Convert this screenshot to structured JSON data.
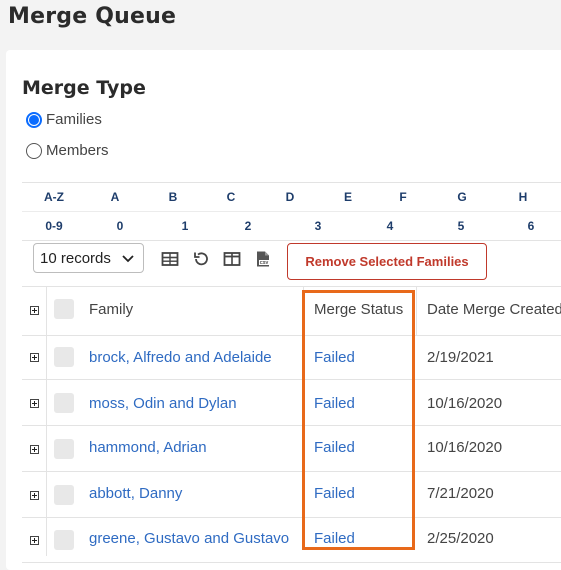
{
  "page": {
    "title": "Merge Queue"
  },
  "merge_type": {
    "title": "Merge Type",
    "options": [
      {
        "label": "Families",
        "checked": true
      },
      {
        "label": "Members",
        "checked": false
      }
    ]
  },
  "alpha_filter": {
    "row1": [
      "A-Z",
      "A",
      "B",
      "C",
      "D",
      "E",
      "F",
      "G",
      "H"
    ],
    "row2": [
      "0-9",
      "0",
      "1",
      "2",
      "3",
      "4",
      "5",
      "6"
    ]
  },
  "toolbar": {
    "records_select": "10 records",
    "icons": [
      "table-icon",
      "refresh-icon",
      "columns-icon",
      "csv-export-icon"
    ],
    "remove_button": "Remove Selected Families"
  },
  "grid": {
    "columns": [
      "Family",
      "Merge Status",
      "Date Merge Created"
    ],
    "rows": [
      {
        "family": "brock, Alfredo and Adelaide",
        "status": "Failed",
        "date": "2/19/2021"
      },
      {
        "family": "moss, Odin and Dylan",
        "status": "Failed",
        "date": "10/16/2020"
      },
      {
        "family": "hammond, Adrian",
        "status": "Failed",
        "date": "10/16/2020"
      },
      {
        "family": "abbott, Danny",
        "status": "Failed",
        "date": "7/21/2020"
      },
      {
        "family": "greene, Gustavo and Gustavo",
        "status": "Failed",
        "date": "2/25/2020"
      }
    ]
  },
  "colors": {
    "accent": "#0a6cff",
    "link": "#2f6bc2",
    "danger": "#c0392b",
    "highlight": "#e8691a"
  }
}
